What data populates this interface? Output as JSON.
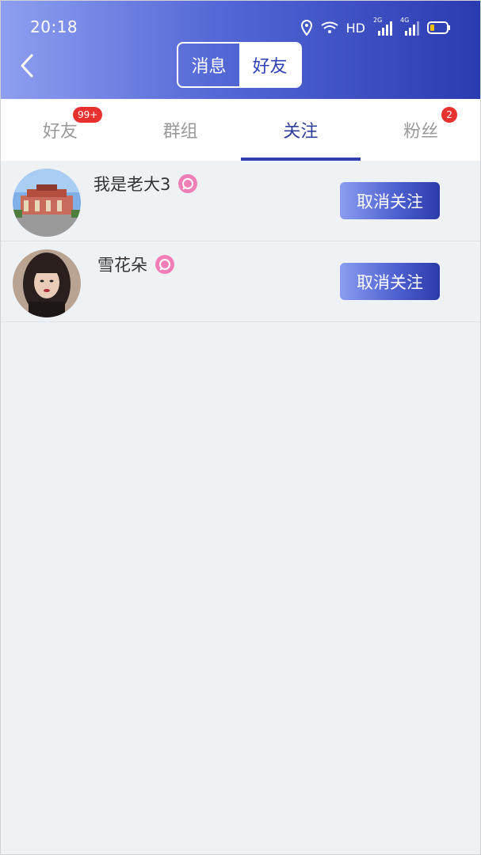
{
  "status_bar": {
    "time": "20:18",
    "hd_label": "HD",
    "net1": "2G",
    "net2": "4G"
  },
  "header": {
    "segments": [
      {
        "label": "消息",
        "active": false
      },
      {
        "label": "好友",
        "active": true
      }
    ]
  },
  "tabs": [
    {
      "label": "好友",
      "badge": "99+"
    },
    {
      "label": "群组",
      "badge": ""
    },
    {
      "label": "关注",
      "badge": "",
      "active": true
    },
    {
      "label": "粉丝",
      "badge": "2"
    }
  ],
  "follow_list": [
    {
      "name": "我是老大3",
      "action": "取消关注"
    },
    {
      "name": "雪花朵",
      "action": "取消关注"
    }
  ],
  "colors": {
    "accent": "#2e3fb3",
    "badge": "#e8302f",
    "pink_badge": "#f07fb8"
  }
}
